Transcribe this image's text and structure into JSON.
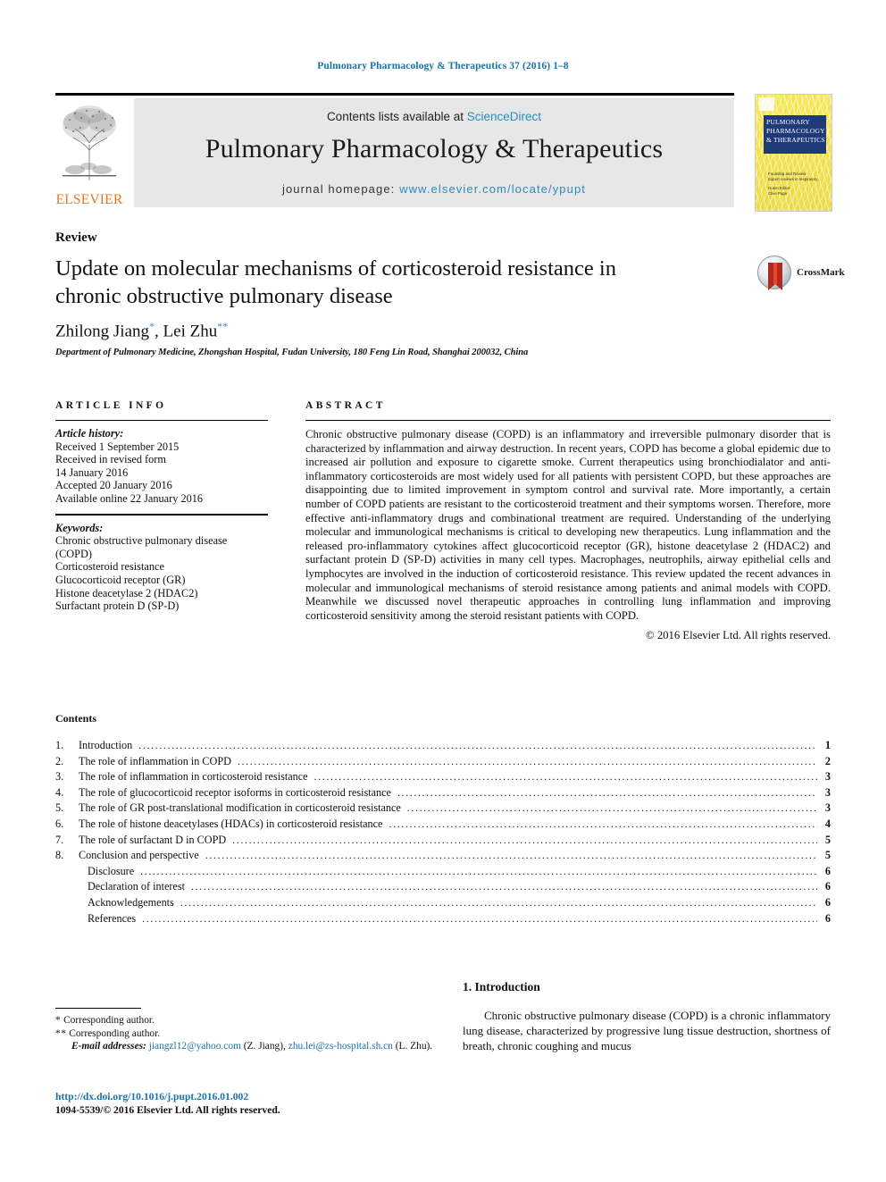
{
  "running_head": "Pulmonary Pharmacology & Therapeutics 37 (2016) 1–8",
  "masthead": {
    "contents_prefix": "Contents lists available at ",
    "sciencedirect": "ScienceDirect",
    "journal_name": "Pulmonary Pharmacology & Therapeutics",
    "homepage_label": "journal homepage: ",
    "homepage_url": "www.elsevier.com/locate/ypupt",
    "publisher": "ELSEVIER",
    "cover": {
      "line1": "PULMONARY",
      "line2": "PHARMACOLOGY",
      "line3": "& THERAPEUTICS",
      "sub1": "Founding and Review",
      "sub2": "Expert reviews in respiratory",
      "sub3": "Guest Editor",
      "sub4": "Clive Page"
    },
    "colors": {
      "link": "#2b8cbe",
      "band_bg": "#e7e7e7",
      "elsevier_orange": "#e87722",
      "cover_yellow": "#f2e14a",
      "cover_navy": "#1f3a79"
    }
  },
  "article": {
    "doctype": "Review",
    "title": "Update on molecular mechanisms of corticosteroid resistance in chronic obstructive pulmonary disease",
    "author1": "Zhilong Jiang",
    "author1_mark": "*",
    "author_sep": ", ",
    "author2": "Lei Zhu",
    "author2_mark": "**",
    "affiliation": "Department of Pulmonary Medicine, Zhongshan Hospital, Fudan University, 180 Feng Lin Road, Shanghai 200032, China",
    "crossmark_label": "CrossMark"
  },
  "article_info": {
    "heading": "ARTICLE INFO",
    "history_label": "Article history:",
    "history": [
      "Received 1 September 2015",
      "Received in revised form",
      "14 January 2016",
      "Accepted 20 January 2016",
      "Available online 22 January 2016"
    ],
    "keywords_label": "Keywords:",
    "keywords": [
      "Chronic obstructive pulmonary disease",
      "(COPD)",
      "Corticosteroid resistance",
      "Glucocorticoid receptor (GR)",
      "Histone deacetylase 2 (HDAC2)",
      "Surfactant protein D (SP-D)"
    ]
  },
  "abstract": {
    "heading": "ABSTRACT",
    "body": "Chronic obstructive pulmonary disease (COPD) is an inflammatory and irreversible pulmonary disorder that is characterized by inflammation and airway destruction. In recent years, COPD has become a global epidemic due to increased air pollution and exposure to cigarette smoke. Current therapeutics using bronchiodialator and anti-inflammatory corticosteroids are most widely used for all patients with persistent COPD, but these approaches are disappointing due to limited improvement in symptom control and survival rate. More importantly, a certain number of COPD patients are resistant to the corticosteroid treatment and their symptoms worsen. Therefore, more effective anti-inflammatory drugs and combinational treatment are required. Understanding of the underlying molecular and immunological mechanisms is critical to developing new therapeutics. Lung inflammation and the released pro-inflammatory cytokines affect glucocorticoid receptor (GR), histone deacetylase 2 (HDAC2) and surfactant protein D (SP-D) activities in many cell types. Macrophages, neutrophils, airway epithelial cells and lymphocytes are involved in the induction of corticosteroid resistance. This review updated the recent advances in molecular and immunological mechanisms of steroid resistance among patients and animal models with COPD. Meanwhile we discussed novel therapeutic approaches in controlling lung inflammation and improving corticosteroid sensitivity among the steroid resistant patients with COPD.",
    "copyright": "© 2016 Elsevier Ltd. All rights reserved."
  },
  "contents": {
    "title": "Contents",
    "items": [
      {
        "num": "1.",
        "label": "Introduction",
        "page": "1",
        "sub": false
      },
      {
        "num": "2.",
        "label": "The role of inflammation in COPD",
        "page": "2",
        "sub": false
      },
      {
        "num": "3.",
        "label": "The role of inflammation in corticosteroid resistance",
        "page": "3",
        "sub": false
      },
      {
        "num": "4.",
        "label": "The role of glucocorticoid receptor isoforms in corticosteroid resistance",
        "page": "3",
        "sub": false
      },
      {
        "num": "5.",
        "label": "The role of GR post-translational modification in corticosteroid resistance",
        "page": "3",
        "sub": false
      },
      {
        "num": "6.",
        "label": "The role of histone deacetylases (HDACs) in corticosteroid resistance",
        "page": "4",
        "sub": false
      },
      {
        "num": "7.",
        "label": "The role of surfactant D in COPD",
        "page": "5",
        "sub": false
      },
      {
        "num": "8.",
        "label": "Conclusion and perspective",
        "page": "5",
        "sub": false
      },
      {
        "num": "",
        "label": "Disclosure",
        "page": "6",
        "sub": true
      },
      {
        "num": "",
        "label": "Declaration of interest",
        "page": "6",
        "sub": true
      },
      {
        "num": "",
        "label": "Acknowledgements",
        "page": "6",
        "sub": true
      },
      {
        "num": "",
        "label": "References",
        "page": "6",
        "sub": true
      }
    ]
  },
  "footnotes": {
    "corr1_mark": "*",
    "corr1": "Corresponding author.",
    "corr2_mark": "**",
    "corr2": "Corresponding author.",
    "email_label": "E-mail addresses:",
    "email1": "jiangzl12@yahoo.com",
    "email1_owner": "(Z. Jiang),",
    "email2": "zhu.lei@zs-hospital.sh.cn",
    "email2_owner": "(L. Zhu).",
    "doi": "http://dx.doi.org/10.1016/j.pupt.2016.01.002",
    "issn": "1094-5539/© 2016 Elsevier Ltd. All rights reserved."
  },
  "introduction": {
    "heading": "1. Introduction",
    "paragraph": "Chronic obstructive pulmonary disease (COPD) is a chronic inflammatory lung disease, characterized by progressive lung tissue destruction, shortness of breath, chronic coughing and mucus"
  }
}
